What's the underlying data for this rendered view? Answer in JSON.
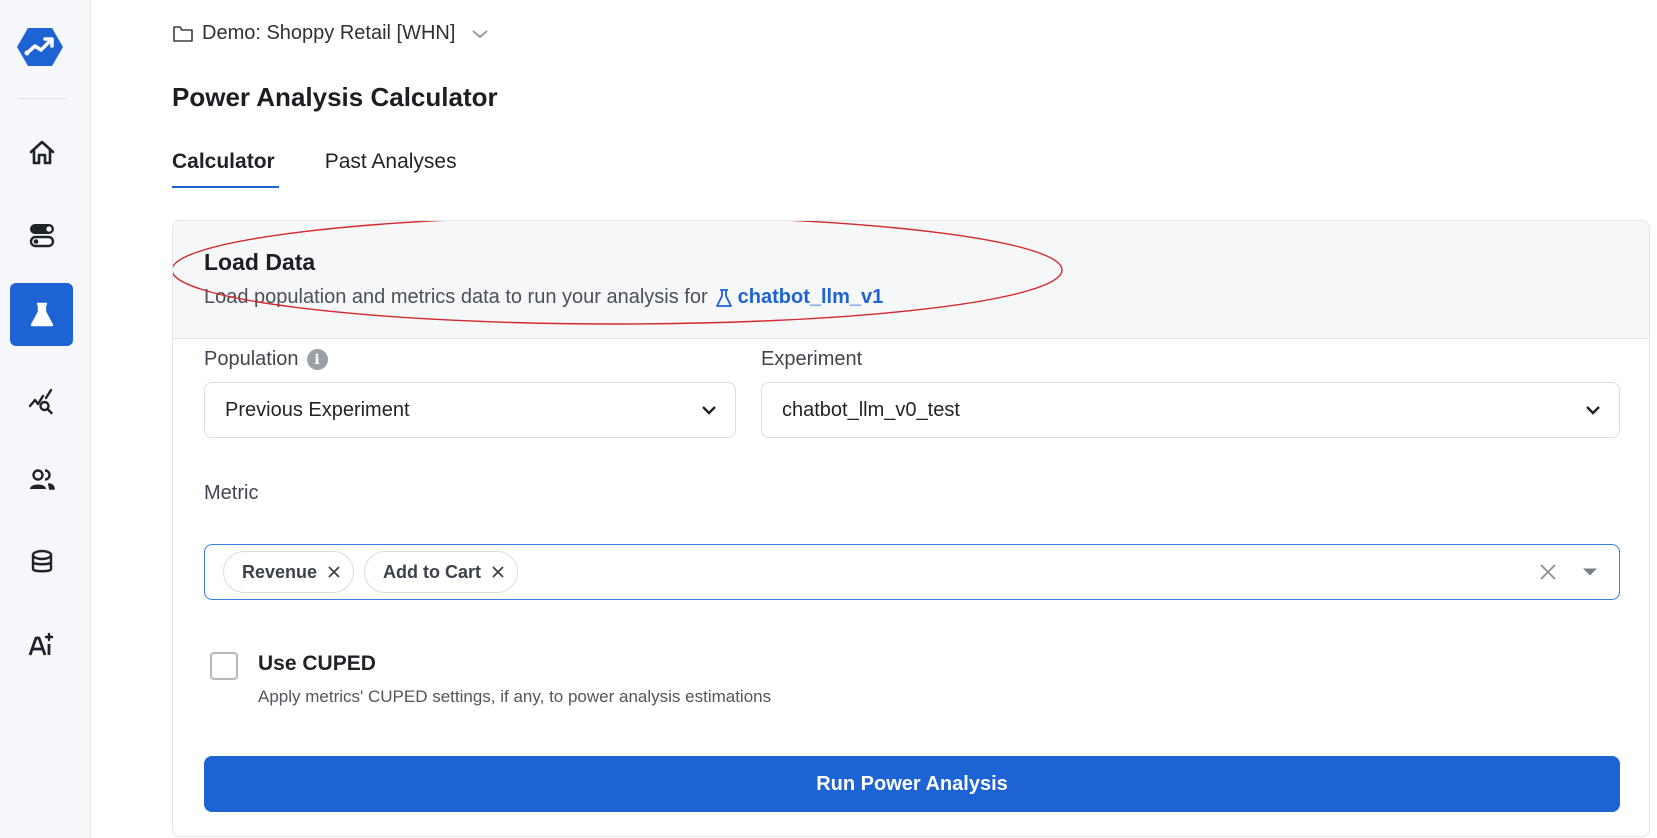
{
  "sidebar": {
    "logo_icon": "trend-hexagon-logo",
    "items": [
      {
        "name": "home",
        "icon": "home-icon",
        "active": false
      },
      {
        "name": "feature-flags",
        "icon": "toggle-icon",
        "active": false
      },
      {
        "name": "experiments",
        "icon": "flask-icon",
        "active": true
      },
      {
        "name": "analytics",
        "icon": "chart-search-icon",
        "active": false
      },
      {
        "name": "users",
        "icon": "users-icon",
        "active": false
      },
      {
        "name": "data",
        "icon": "database-icon",
        "active": false
      },
      {
        "name": "ai",
        "icon": "ai-sparkle-icon",
        "active": false
      }
    ]
  },
  "header": {
    "workspace": "Demo: Shoppy Retail [WHN]",
    "title": "Power Analysis Calculator"
  },
  "tabs": [
    {
      "label": "Calculator",
      "active": true
    },
    {
      "label": "Past Analyses",
      "active": false
    }
  ],
  "load_data": {
    "title": "Load Data",
    "subtitle": "Load population and metrics data to run your analysis for",
    "experiment_link": "chatbot_llm_v1"
  },
  "form": {
    "population_label": "Population",
    "population_value": "Previous Experiment",
    "experiment_label": "Experiment",
    "experiment_value": "chatbot_llm_v0_test",
    "metric_label": "Metric",
    "metrics": [
      "Revenue",
      "Add to Cart"
    ],
    "cuped_label": "Use CUPED",
    "cuped_description": "Apply metrics' CUPED settings, if any, to power analysis estimations",
    "cuped_checked": false,
    "run_button": "Run Power Analysis"
  },
  "colors": {
    "accent": "#1d63d4",
    "annotation": "#d42a2a"
  }
}
